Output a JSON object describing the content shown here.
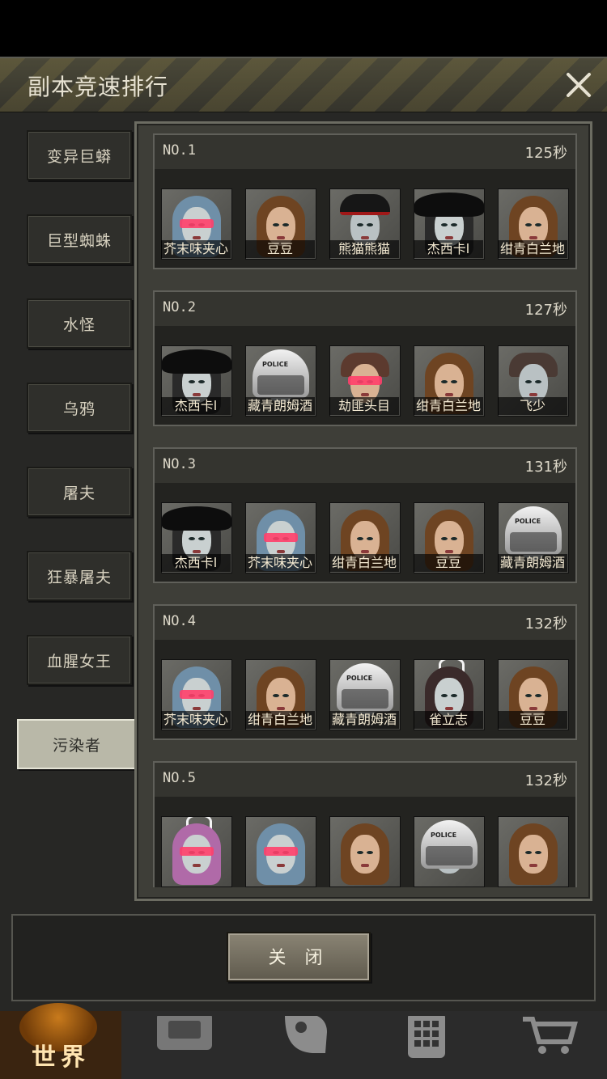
{
  "dialog": {
    "title": "副本竞速排行",
    "close_label": "关 闭"
  },
  "side_tabs": [
    {
      "label": "变异巨蟒",
      "active": false
    },
    {
      "label": "巨型蜘蛛",
      "active": false
    },
    {
      "label": "水怪",
      "active": false
    },
    {
      "label": "乌鸦",
      "active": false
    },
    {
      "label": "屠夫",
      "active": false
    },
    {
      "label": "狂暴屠夫",
      "active": false
    },
    {
      "label": "血腥女王",
      "active": false
    },
    {
      "label": "污染者",
      "active": true
    }
  ],
  "rankings": [
    {
      "rank": "NO.1",
      "time": "125秒",
      "members": [
        {
          "name": "芥末味夹心",
          "portrait": "blue-hair-glasses-icon"
        },
        {
          "name": "豆豆",
          "portrait": "brown-hair-woman-icon"
        },
        {
          "name": "熊猫熊猫",
          "portrait": "officer-cap-man-icon"
        },
        {
          "name": "杰西卡l",
          "portrait": "pirate-hat-woman-icon"
        },
        {
          "name": "绀青白兰地",
          "portrait": "brown-hair-woman-icon"
        }
      ]
    },
    {
      "rank": "NO.2",
      "time": "127秒",
      "members": [
        {
          "name": "杰西卡l",
          "portrait": "pirate-hat-woman-icon"
        },
        {
          "name": "藏青朗姆酒",
          "portrait": "police-helmet-icon"
        },
        {
          "name": "劫匪头目",
          "portrait": "red-glasses-man-icon"
        },
        {
          "name": "绀青白兰地",
          "portrait": "brown-hair-woman-icon"
        },
        {
          "name": "飞少",
          "portrait": "scarred-man-icon"
        }
      ]
    },
    {
      "rank": "NO.3",
      "time": "131秒",
      "members": [
        {
          "name": "杰西卡l",
          "portrait": "pirate-hat-woman-icon"
        },
        {
          "name": "芥末味夹心",
          "portrait": "blue-hair-glasses-icon"
        },
        {
          "name": "绀青白兰地",
          "portrait": "brown-hair-woman-icon"
        },
        {
          "name": "豆豆",
          "portrait": "brown-hair-woman-icon"
        },
        {
          "name": "藏青朗姆酒",
          "portrait": "police-helmet-icon"
        }
      ]
    },
    {
      "rank": "NO.4",
      "time": "132秒",
      "members": [
        {
          "name": "芥末味夹心",
          "portrait": "blue-hair-glasses-icon"
        },
        {
          "name": "绀青白兰地",
          "portrait": "brown-hair-woman-icon"
        },
        {
          "name": "藏青朗姆酒",
          "portrait": "police-helmet-icon"
        },
        {
          "name": "雀立志",
          "portrait": "bunny-ears-woman-icon"
        },
        {
          "name": "豆豆",
          "portrait": "brown-hair-woman-icon"
        }
      ]
    },
    {
      "rank": "NO.5",
      "time": "132秒",
      "members": [
        {
          "name": "",
          "portrait": "pink-hair-bunny-icon"
        },
        {
          "name": "",
          "portrait": "blue-hair-glasses-icon"
        },
        {
          "name": "",
          "portrait": "brown-hair-woman-icon"
        },
        {
          "name": "",
          "portrait": "police-helmet-icon"
        },
        {
          "name": "",
          "portrait": "brown-hair-woman-icon"
        }
      ]
    }
  ],
  "bottom_nav": [
    {
      "label": "世界",
      "icon": "globe-icon",
      "active": true
    },
    {
      "label": "",
      "icon": "backpack-icon",
      "active": false
    },
    {
      "label": "",
      "icon": "head-gear-icon",
      "active": false
    },
    {
      "label": "",
      "icon": "phone-icon",
      "active": false
    },
    {
      "label": "",
      "icon": "cart-icon",
      "active": false
    }
  ]
}
